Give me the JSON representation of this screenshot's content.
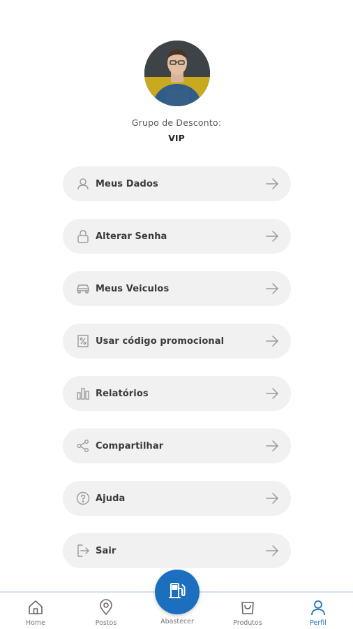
{
  "profile": {
    "group_label": "Grupo de Desconto:",
    "group_value": "VIP"
  },
  "menu": {
    "items": [
      {
        "label": "Meus Dados",
        "icon": "user-icon"
      },
      {
        "label": "Alterar Senha",
        "icon": "lock-icon"
      },
      {
        "label": "Meus Veiculos",
        "icon": "car-icon"
      },
      {
        "label": "Usar código promocional",
        "icon": "percent-tag-icon"
      },
      {
        "label": "Relatórios",
        "icon": "bar-chart-icon"
      },
      {
        "label": "Compartilhar",
        "icon": "share-icon"
      },
      {
        "label": "Ajuda",
        "icon": "help-icon"
      },
      {
        "label": "Sair",
        "icon": "logout-icon"
      }
    ],
    "arrow_icon": "arrow-right-icon"
  },
  "nav": {
    "home": "Home",
    "postos": "Postos",
    "abastecer": "Abastecer",
    "produtos": "Produtos",
    "perfil": "Perfil",
    "active": "perfil"
  },
  "colors": {
    "accent": "#1c6fbf",
    "menu_bg": "#f1f1f1",
    "icon_gray": "#9a9a9a"
  }
}
